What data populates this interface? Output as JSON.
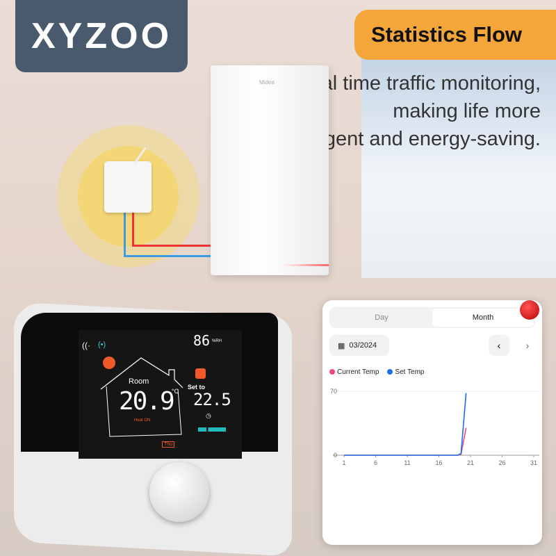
{
  "brand": {
    "logo": "XYZOO"
  },
  "banner": {
    "title": "Statistics Flow"
  },
  "tagline": {
    "lines": [
      "Real time traffic monitoring,",
      "making life more",
      "intelligent and energy-saving."
    ]
  },
  "boiler": {
    "brand": "Midea"
  },
  "thermostat": {
    "humidity": "86",
    "humidity_unit": "%RH",
    "room_label": "Room",
    "room_temp": "20.9",
    "unit": "°C",
    "set_label": "Set to",
    "set_temp": "22.5",
    "heat_status": "Heat ON",
    "day": "Thu",
    "icons": [
      "wifi-icon",
      "signal-icon",
      "sun-icon",
      "home-icon",
      "clock-icon",
      "thermometer-icon"
    ]
  },
  "app": {
    "tabs": [
      {
        "label": "Day",
        "active": false
      },
      {
        "label": "Month",
        "active": true
      }
    ],
    "date": "03/2024",
    "colors": {
      "current": "#f0497f",
      "set": "#1a6fe8"
    }
  },
  "chart_data": {
    "type": "line",
    "title": "",
    "xlabel": "",
    "ylabel": "",
    "xlim": [
      1,
      31
    ],
    "ylim": [
      0,
      70
    ],
    "x_ticks": [
      "1",
      "6",
      "11",
      "16",
      "21",
      "26",
      "31"
    ],
    "y_ticks": [
      "0",
      "70"
    ],
    "legend_position": "top-left",
    "series": [
      {
        "name": "Current Temp",
        "color": "#f0497f",
        "x": [
          1,
          5,
          10,
          15,
          19,
          19.5,
          20.3
        ],
        "y": [
          0,
          0,
          0,
          0,
          0,
          1,
          30
        ]
      },
      {
        "name": "Set Temp",
        "color": "#1a6fe8",
        "x": [
          1,
          5,
          10,
          15,
          19,
          19.5,
          20.3
        ],
        "y": [
          0,
          0,
          0,
          0,
          0,
          2,
          68
        ]
      }
    ]
  }
}
